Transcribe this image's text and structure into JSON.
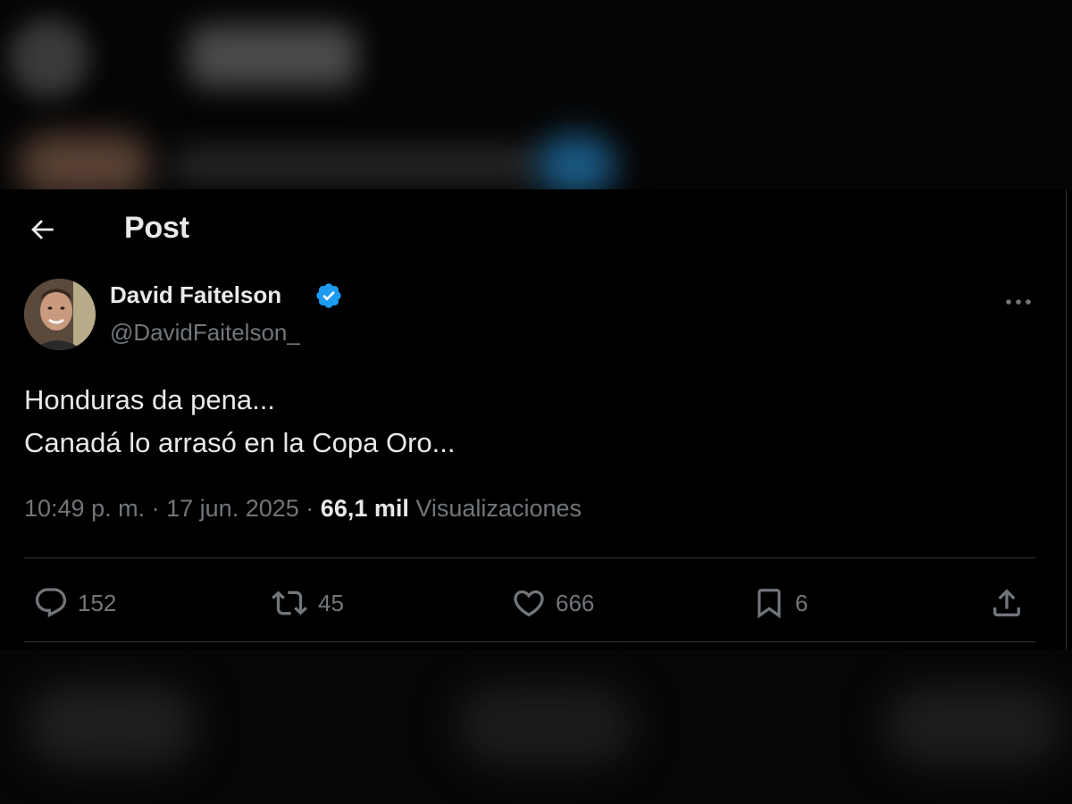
{
  "header": {
    "title": "Post",
    "back_icon": "arrow-left-icon"
  },
  "author": {
    "name": "David Faitelson",
    "handle": "@DavidFaitelson_",
    "verified": true,
    "verified_color": "#1d9bf0"
  },
  "post": {
    "lines": [
      "Honduras da pena...",
      "Canadá lo arrasó en la Copa Oro..."
    ]
  },
  "meta": {
    "time": "10:49 p. m.",
    "separator": "·",
    "date": "17 jun. 2025",
    "views_count": "66,1 mil",
    "views_label": "Visualizaciones"
  },
  "actions": {
    "replies": "152",
    "reposts": "45",
    "likes": "666",
    "bookmarks": "6"
  },
  "colors": {
    "background": "#000000",
    "text_primary": "#e7e9ea",
    "text_secondary": "#71767b",
    "divider": "#2f3336"
  }
}
